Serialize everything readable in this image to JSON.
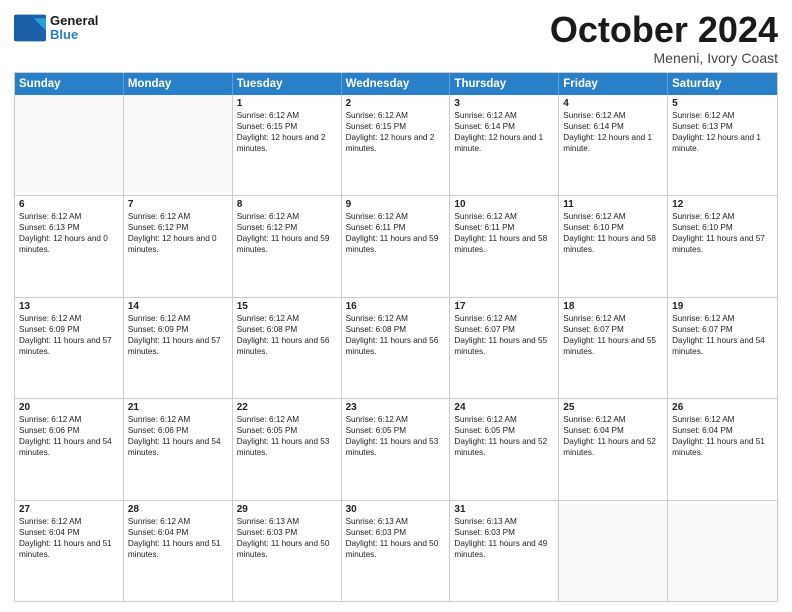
{
  "logo": {
    "line1": "General",
    "line2": "Blue"
  },
  "header": {
    "month": "October 2024",
    "location": "Meneni, Ivory Coast"
  },
  "days_of_week": [
    "Sunday",
    "Monday",
    "Tuesday",
    "Wednesday",
    "Thursday",
    "Friday",
    "Saturday"
  ],
  "weeks": [
    [
      {
        "day": "",
        "text": "",
        "empty": true
      },
      {
        "day": "",
        "text": "",
        "empty": true
      },
      {
        "day": "1",
        "text": "Sunrise: 6:12 AM\nSunset: 6:15 PM\nDaylight: 12 hours and 2 minutes.",
        "empty": false
      },
      {
        "day": "2",
        "text": "Sunrise: 6:12 AM\nSunset: 6:15 PM\nDaylight: 12 hours and 2 minutes.",
        "empty": false
      },
      {
        "day": "3",
        "text": "Sunrise: 6:12 AM\nSunset: 6:14 PM\nDaylight: 12 hours and 1 minute.",
        "empty": false
      },
      {
        "day": "4",
        "text": "Sunrise: 6:12 AM\nSunset: 6:14 PM\nDaylight: 12 hours and 1 minute.",
        "empty": false
      },
      {
        "day": "5",
        "text": "Sunrise: 6:12 AM\nSunset: 6:13 PM\nDaylight: 12 hours and 1 minute.",
        "empty": false
      }
    ],
    [
      {
        "day": "6",
        "text": "Sunrise: 6:12 AM\nSunset: 6:13 PM\nDaylight: 12 hours and 0 minutes.",
        "empty": false
      },
      {
        "day": "7",
        "text": "Sunrise: 6:12 AM\nSunset: 6:12 PM\nDaylight: 12 hours and 0 minutes.",
        "empty": false
      },
      {
        "day": "8",
        "text": "Sunrise: 6:12 AM\nSunset: 6:12 PM\nDaylight: 11 hours and 59 minutes.",
        "empty": false
      },
      {
        "day": "9",
        "text": "Sunrise: 6:12 AM\nSunset: 6:11 PM\nDaylight: 11 hours and 59 minutes.",
        "empty": false
      },
      {
        "day": "10",
        "text": "Sunrise: 6:12 AM\nSunset: 6:11 PM\nDaylight: 11 hours and 58 minutes.",
        "empty": false
      },
      {
        "day": "11",
        "text": "Sunrise: 6:12 AM\nSunset: 6:10 PM\nDaylight: 11 hours and 58 minutes.",
        "empty": false
      },
      {
        "day": "12",
        "text": "Sunrise: 6:12 AM\nSunset: 6:10 PM\nDaylight: 11 hours and 57 minutes.",
        "empty": false
      }
    ],
    [
      {
        "day": "13",
        "text": "Sunrise: 6:12 AM\nSunset: 6:09 PM\nDaylight: 11 hours and 57 minutes.",
        "empty": false
      },
      {
        "day": "14",
        "text": "Sunrise: 6:12 AM\nSunset: 6:09 PM\nDaylight: 11 hours and 57 minutes.",
        "empty": false
      },
      {
        "day": "15",
        "text": "Sunrise: 6:12 AM\nSunset: 6:08 PM\nDaylight: 11 hours and 56 minutes.",
        "empty": false
      },
      {
        "day": "16",
        "text": "Sunrise: 6:12 AM\nSunset: 6:08 PM\nDaylight: 11 hours and 56 minutes.",
        "empty": false
      },
      {
        "day": "17",
        "text": "Sunrise: 6:12 AM\nSunset: 6:07 PM\nDaylight: 11 hours and 55 minutes.",
        "empty": false
      },
      {
        "day": "18",
        "text": "Sunrise: 6:12 AM\nSunset: 6:07 PM\nDaylight: 11 hours and 55 minutes.",
        "empty": false
      },
      {
        "day": "19",
        "text": "Sunrise: 6:12 AM\nSunset: 6:07 PM\nDaylight: 11 hours and 54 minutes.",
        "empty": false
      }
    ],
    [
      {
        "day": "20",
        "text": "Sunrise: 6:12 AM\nSunset: 6:06 PM\nDaylight: 11 hours and 54 minutes.",
        "empty": false
      },
      {
        "day": "21",
        "text": "Sunrise: 6:12 AM\nSunset: 6:06 PM\nDaylight: 11 hours and 54 minutes.",
        "empty": false
      },
      {
        "day": "22",
        "text": "Sunrise: 6:12 AM\nSunset: 6:05 PM\nDaylight: 11 hours and 53 minutes.",
        "empty": false
      },
      {
        "day": "23",
        "text": "Sunrise: 6:12 AM\nSunset: 6:05 PM\nDaylight: 11 hours and 53 minutes.",
        "empty": false
      },
      {
        "day": "24",
        "text": "Sunrise: 6:12 AM\nSunset: 6:05 PM\nDaylight: 11 hours and 52 minutes.",
        "empty": false
      },
      {
        "day": "25",
        "text": "Sunrise: 6:12 AM\nSunset: 6:04 PM\nDaylight: 11 hours and 52 minutes.",
        "empty": false
      },
      {
        "day": "26",
        "text": "Sunrise: 6:12 AM\nSunset: 6:04 PM\nDaylight: 11 hours and 51 minutes.",
        "empty": false
      }
    ],
    [
      {
        "day": "27",
        "text": "Sunrise: 6:12 AM\nSunset: 6:04 PM\nDaylight: 11 hours and 51 minutes.",
        "empty": false
      },
      {
        "day": "28",
        "text": "Sunrise: 6:12 AM\nSunset: 6:04 PM\nDaylight: 11 hours and 51 minutes.",
        "empty": false
      },
      {
        "day": "29",
        "text": "Sunrise: 6:13 AM\nSunset: 6:03 PM\nDaylight: 11 hours and 50 minutes.",
        "empty": false
      },
      {
        "day": "30",
        "text": "Sunrise: 6:13 AM\nSunset: 6:03 PM\nDaylight: 11 hours and 50 minutes.",
        "empty": false
      },
      {
        "day": "31",
        "text": "Sunrise: 6:13 AM\nSunset: 6:03 PM\nDaylight: 11 hours and 49 minutes.",
        "empty": false
      },
      {
        "day": "",
        "text": "",
        "empty": true
      },
      {
        "day": "",
        "text": "",
        "empty": true
      }
    ]
  ]
}
